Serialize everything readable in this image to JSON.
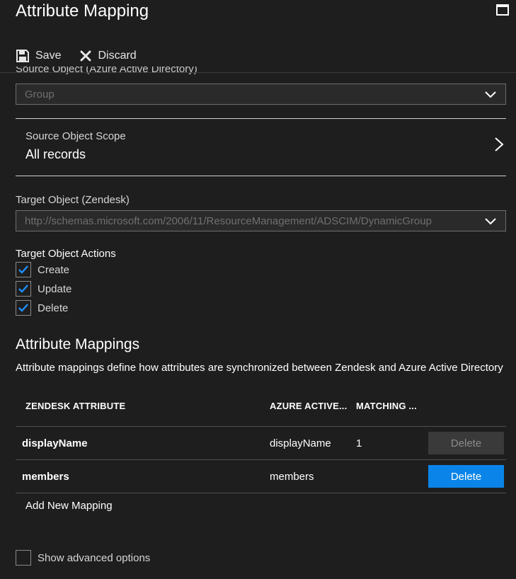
{
  "header": {
    "title": "Attribute Mapping"
  },
  "toolbar": {
    "save_label": "Save",
    "discard_label": "Discard"
  },
  "source": {
    "label": "Source Object (Azure Active Directory)",
    "value": "Group"
  },
  "scope": {
    "label": "Source Object Scope",
    "value": "All records"
  },
  "target": {
    "label": "Target Object (Zendesk)",
    "value": "http://schemas.microsoft.com/2006/11/ResourceManagement/ADSCIM/DynamicGroup"
  },
  "actions": {
    "title": "Target Object Actions",
    "items": [
      {
        "label": "Create",
        "checked": true
      },
      {
        "label": "Update",
        "checked": true
      },
      {
        "label": "Delete",
        "checked": true
      }
    ]
  },
  "mappings": {
    "title": "Attribute Mappings",
    "description": "Attribute mappings define how attributes are synchronized between Zendesk and Azure Active Directory",
    "columns": [
      "ZENDESK ATTRIBUTE",
      "AZURE ACTIVE...",
      "MATCHING ..."
    ],
    "rows": [
      {
        "zendesk": "displayName",
        "azure": "displayName",
        "matching": "1",
        "delete_label": "Delete",
        "delete_enabled": false
      },
      {
        "zendesk": "members",
        "azure": "members",
        "matching": "",
        "delete_label": "Delete",
        "delete_enabled": true
      }
    ],
    "add_label": "Add New Mapping"
  },
  "advanced": {
    "label": "Show advanced options",
    "checked": false
  },
  "colors": {
    "accent": "#0a84e8",
    "background": "#1e1e1e",
    "checkmark": "#1e90ff"
  }
}
